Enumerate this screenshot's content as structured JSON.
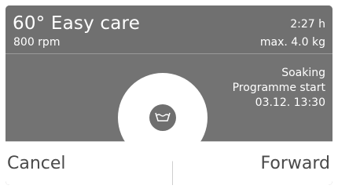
{
  "programme": {
    "name": "60° Easy care",
    "spin": "800 rpm",
    "duration": "2:27 h",
    "max_load": "max. 4.0 kg"
  },
  "status": {
    "phase": "Soaking",
    "start_label": "Programme start",
    "start_time": "03.12.  13:30"
  },
  "actions": {
    "cancel_label": "Cancel",
    "forward_label": "Forward"
  },
  "icons": {
    "center": "wash-basin-icon"
  },
  "colors": {
    "panel": "#737373",
    "text_light": "#ffffff",
    "button_text": "#4a4a4a"
  }
}
